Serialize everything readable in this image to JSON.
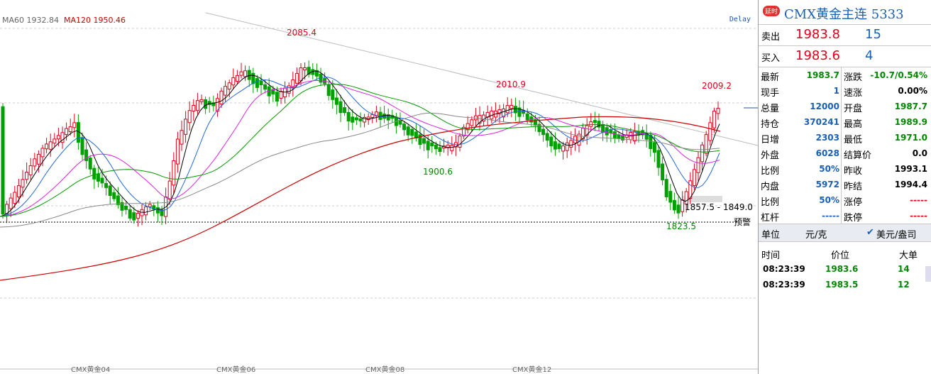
{
  "chart": {
    "ma60_label": "MA60 1932.84",
    "ma120_label": "MA120 1950.46",
    "delay_label": "Delay",
    "annotations": {
      "high_2085": "2085.4",
      "high_2010": "2010.9",
      "high_2009": "2009.2",
      "low_1900": "1900.6",
      "low_1823": "1823.5",
      "range_label": "1857.5 - 1849.0",
      "alert_label": "预警"
    },
    "x_labels": [
      "CMX黄金04",
      "CMX黄金06",
      "CMX黄金08",
      "CMX黄金12"
    ],
    "colors": {
      "up": "#e0001a",
      "down": "#00a000",
      "ma5": "#000000",
      "ma10": "#2266dd",
      "ma20": "#dd22dd",
      "ma30": "#009900",
      "ma60": "#888888",
      "ma120": "#cc0000"
    }
  },
  "panel": {
    "badge": "延时",
    "title": "CMX黄金主连  5333",
    "sell_label": "卖出",
    "sell_price": "1983.8",
    "sell_vol": "15",
    "buy_label": "买入",
    "buy_price": "1983.6",
    "buy_vol": "4",
    "stats": [
      {
        "l1": "最新",
        "v1": "1983.7",
        "c1": "green",
        "l2": "涨跌",
        "v2": "-10.7/0.54%",
        "c2": "green"
      },
      {
        "l1": "现手",
        "v1": "1",
        "c1": "blue",
        "l2": "速涨",
        "v2": "0.00%",
        "c2": "black"
      },
      {
        "l1": "总量",
        "v1": "12000",
        "c1": "blue",
        "l2": "开盘",
        "v2": "1987.7",
        "c2": "green"
      },
      {
        "l1": "持仓",
        "v1": "370241",
        "c1": "blue",
        "l2": "最高",
        "v2": "1989.9",
        "c2": "green"
      },
      {
        "l1": "日增",
        "v1": "2303",
        "c1": "blue",
        "l2": "最低",
        "v2": "1971.0",
        "c2": "green"
      },
      {
        "l1": "外盘",
        "v1": "6028",
        "c1": "blue",
        "l2": "结算价",
        "v2": "0.0",
        "c2": "black"
      },
      {
        "l1": "比例",
        "v1": "50%",
        "c1": "blue",
        "l2": "昨收",
        "v2": "1993.1",
        "c2": "black"
      },
      {
        "l1": "内盘",
        "v1": "5972",
        "c1": "blue",
        "l2": "昨结",
        "v2": "1994.4",
        "c2": "black"
      },
      {
        "l1": "比例",
        "v1": "50%",
        "c1": "blue",
        "l2": "涨停",
        "v2": "-----",
        "c2": "red"
      },
      {
        "l1": "杠杆",
        "v1": "-----",
        "c1": "blue",
        "l2": "跌停",
        "v2": "-----",
        "c2": "red"
      }
    ],
    "unit_label": "单位",
    "unit_value": "元/克",
    "unit_alt": "美元/盎司",
    "tick_headers": {
      "time": "时间",
      "price": "价位",
      "size": "大单"
    },
    "ticks": [
      {
        "time": "08:23:39",
        "price": "1983.6",
        "size": "14"
      },
      {
        "time": "08:23:39",
        "price": "1983.5",
        "size": "12"
      }
    ]
  }
}
